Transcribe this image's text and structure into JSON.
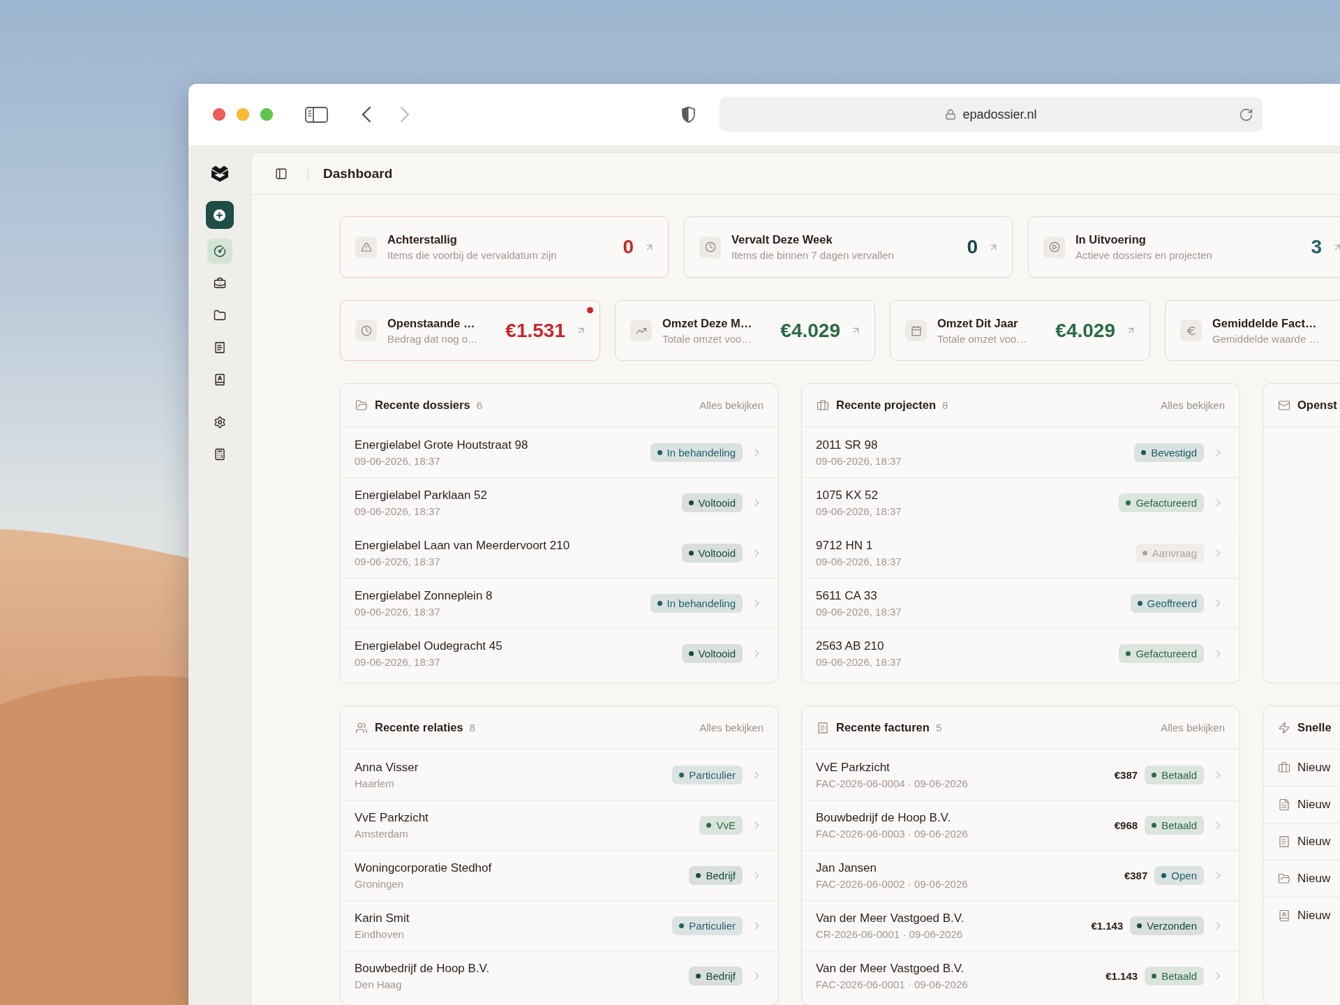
{
  "browser": {
    "url": "epadossier.nl",
    "can_go_back": true,
    "can_go_forward": false
  },
  "sidebar": {
    "nav_items": [
      {
        "selected": true
      },
      {
        "selected": false
      },
      {
        "selected": false
      },
      {
        "selected": false
      },
      {
        "selected": false
      }
    ],
    "tool_items": [
      {
        "selected": false
      },
      {
        "selected": false
      }
    ]
  },
  "header": {
    "title": "Dashboard"
  },
  "summary_cards": [
    {
      "title": "Achterstallig",
      "subtitle": "Items die voorbij de vervaldatum zijn",
      "value": "0",
      "color": "#c8262c",
      "alert": true
    },
    {
      "title": "Vervalt Deze Week",
      "subtitle": "Items die binnen 7 dagen vervallen",
      "value": "0",
      "color": "#15484a",
      "alert": false
    },
    {
      "title": "In Uitvoering",
      "subtitle": "Actieve dossiers en projecten",
      "value": "3",
      "color": "#22606a",
      "alert": false
    }
  ],
  "finance_cards": [
    {
      "title": "Openstaande …",
      "subtitle": "Bedrag dat nog o…",
      "value": "€1.531",
      "color": "#c8262c",
      "alert": true,
      "notification": true
    },
    {
      "title": "Omzet Deze M…",
      "subtitle": "Totale omzet voo…",
      "value": "€4.029",
      "color": "#2a6a45",
      "alert": false,
      "notification": false
    },
    {
      "title": "Omzet Dit Jaar",
      "subtitle": "Totale omzet voo…",
      "value": "€4.029",
      "color": "#2a6a45",
      "alert": false,
      "notification": false
    },
    {
      "title": "Gemiddelde Fact…",
      "subtitle": "Gemiddelde waarde …",
      "alert": false,
      "notification": false
    }
  ],
  "panels": [
    {
      "kind": "list",
      "title": "Recente dossiers",
      "count": "6",
      "link": "Alles bekijken",
      "rows": [
        {
          "title": "Energielabel Grote Houtstraat 98",
          "subtitle": "09-06-2026, 18:37",
          "badge": {
            "label": "In behandeling",
            "color": "#1f5f66"
          }
        },
        {
          "title": "Energielabel Parklaan 52",
          "subtitle": "09-06-2026, 18:37",
          "badge": {
            "label": "Voltooid",
            "color": "#174a40"
          }
        },
        {
          "title": "Energielabel Laan van Meerdervoort 210",
          "subtitle": "09-06-2026, 18:37",
          "badge": {
            "label": "Voltooid",
            "color": "#174a40"
          }
        },
        {
          "title": "Energielabel Zonneplein 8",
          "subtitle": "09-06-2026, 18:37",
          "badge": {
            "label": "In behandeling",
            "color": "#1f5f66"
          }
        },
        {
          "title": "Energielabel Oudegracht 45",
          "subtitle": "09-06-2026, 18:37",
          "badge": {
            "label": "Voltooid",
            "color": "#174a40"
          }
        }
      ]
    },
    {
      "kind": "list",
      "title": "Recente projecten",
      "count": "8",
      "link": "Alles bekijken",
      "rows": [
        {
          "title": "2011 SR 98",
          "subtitle": "09-06-2026, 18:37",
          "badge": {
            "label": "Bevestigd",
            "color": "#1b5a5e"
          }
        },
        {
          "title": "1075 KX 52",
          "subtitle": "09-06-2026, 18:37",
          "badge": {
            "label": "Gefactureerd",
            "color": "#2b6b45"
          }
        },
        {
          "title": "9712 HN 1",
          "subtitle": "09-06-2026, 18:37",
          "badge": {
            "label": "Aanvraag",
            "color": "#b0a29f"
          }
        },
        {
          "title": "5611 CA 33",
          "subtitle": "09-06-2026, 18:37",
          "badge": {
            "label": "Geoffreerd",
            "color": "#1f5f66"
          }
        },
        {
          "title": "2563 AB 210",
          "subtitle": "09-06-2026, 18:37",
          "badge": {
            "label": "Gefactureerd",
            "color": "#2b6b45"
          }
        }
      ]
    },
    {
      "kind": "list",
      "title": "Openst"
    },
    {
      "kind": "list",
      "title": "Recente relaties",
      "count": "8",
      "link": "Alles bekijken",
      "rows": [
        {
          "title": "Anna Visser",
          "subtitle": "Haarlem",
          "badge": {
            "label": "Particulier",
            "color": "#2a6068"
          }
        },
        {
          "title": "VvE Parkzicht",
          "subtitle": "Amsterdam",
          "badge": {
            "label": "VvE",
            "color": "#2b6b45"
          }
        },
        {
          "title": "Woningcorporatie Stedhof",
          "subtitle": "Groningen",
          "badge": {
            "label": "Bedrijf",
            "color": "#174a40"
          }
        },
        {
          "title": "Karin Smit",
          "subtitle": "Eindhoven",
          "badge": {
            "label": "Particulier",
            "color": "#2a6068"
          }
        },
        {
          "title": "Bouwbedrijf de Hoop B.V.",
          "subtitle": "Den Haag",
          "badge": {
            "label": "Bedrijf",
            "color": "#174a40"
          }
        }
      ]
    },
    {
      "kind": "list",
      "title": "Recente facturen",
      "count": "5",
      "link": "Alles bekijken",
      "rows": [
        {
          "title": "VvE Parkzicht",
          "subtitle": "FAC-2026-06-0004 · 09-06-2026",
          "amount": "€387",
          "badge": {
            "label": "Betaald",
            "color": "#2b6b45"
          }
        },
        {
          "title": "Bouwbedrijf de Hoop B.V.",
          "subtitle": "FAC-2026-06-0003 · 09-06-2026",
          "amount": "€968",
          "badge": {
            "label": "Betaald",
            "color": "#2b6b45"
          }
        },
        {
          "title": "Jan Jansen",
          "subtitle": "FAC-2026-06-0002 · 09-06-2026",
          "amount": "€387",
          "badge": {
            "label": "Open",
            "color": "#1f5f66"
          }
        },
        {
          "title": "Van der Meer Vastgoed B.V.",
          "subtitle": "CR-2026-06-0001 · 09-06-2026",
          "amount": "€1.143",
          "badge": {
            "label": "Verzonden",
            "color": "#174a40"
          }
        },
        {
          "title": "Van der Meer Vastgoed B.V.",
          "subtitle": "FAC-2026-06-0001 · 09-06-2026",
          "amount": "€1.143",
          "badge": {
            "label": "Betaald",
            "color": "#2b6b45"
          }
        }
      ]
    },
    {
      "kind": "actions",
      "title": "Snelle",
      "items": [
        {
          "label": "Nieuw"
        },
        {
          "label": "Nieuw"
        },
        {
          "label": "Nieuw"
        },
        {
          "label": "Nieuw"
        },
        {
          "label": "Nieuw"
        }
      ]
    }
  ]
}
